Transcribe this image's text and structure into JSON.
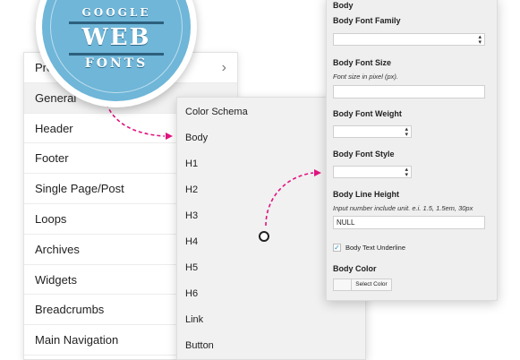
{
  "badge": {
    "line1": "GOOGLE",
    "line2": "WEB",
    "line3": "FONTS"
  },
  "left_menu": {
    "items": [
      {
        "label": "Pres",
        "active": false
      },
      {
        "label": "General",
        "active": true
      },
      {
        "label": "Header"
      },
      {
        "label": "Footer"
      },
      {
        "label": "Single Page/Post"
      },
      {
        "label": "Loops"
      },
      {
        "label": "Archives"
      },
      {
        "label": "Widgets"
      },
      {
        "label": "Breadcrumbs"
      },
      {
        "label": "Main Navigation"
      }
    ]
  },
  "sub_menu": {
    "items": [
      "Color Schema",
      "Body",
      "H1",
      "H2",
      "H3",
      "H4",
      "H5",
      "H6",
      "Link",
      "Button"
    ]
  },
  "settings": {
    "title": "Body",
    "font_family_label": "Body Font Family",
    "font_size_label": "Body Font Size",
    "font_size_hint": "Font size in pixel (px).",
    "font_size_value": "",
    "font_weight_label": "Body Font Weight",
    "font_style_label": "Body Font Style",
    "line_height_label": "Body Line Height",
    "line_height_hint": "Input number include unit. e.i. 1.5, 1.5em, 30px",
    "line_height_value": "NULL",
    "underline_label": "Body Text Underline",
    "underline_checked": true,
    "color_label": "Body Color",
    "select_color_label": "Select Color"
  },
  "colors": {
    "accent_arrow": "#e0137f",
    "badge_blue": "#6fb6d8"
  }
}
